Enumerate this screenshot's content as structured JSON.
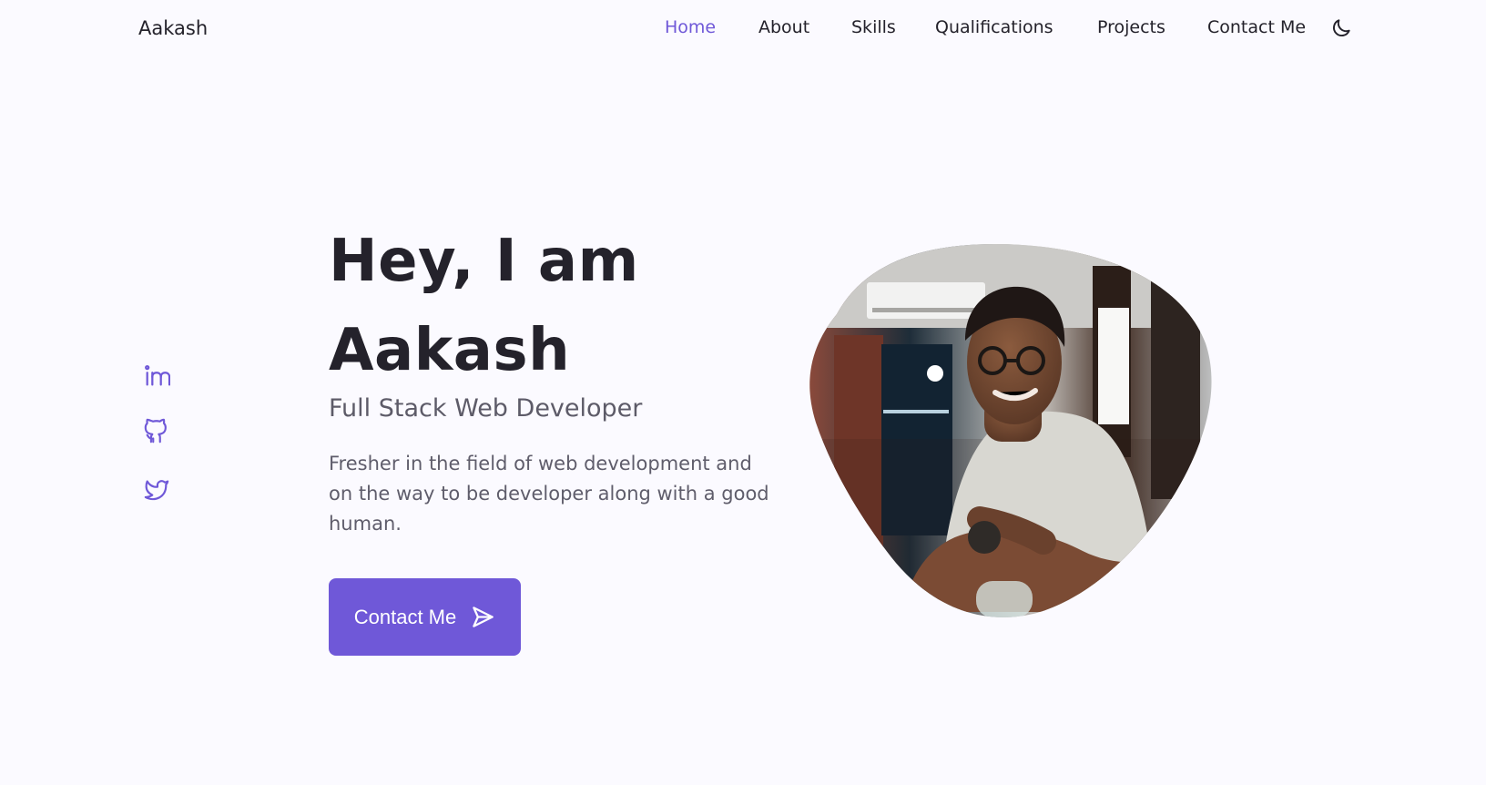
{
  "header": {
    "logo": "Aakash",
    "nav": [
      {
        "label": "Home",
        "active": true
      },
      {
        "label": "About",
        "active": false
      },
      {
        "label": "Skills",
        "active": false
      },
      {
        "label": "Qualifications",
        "active": false
      },
      {
        "label": "Projects",
        "active": false
      },
      {
        "label": "Contact Me",
        "active": false
      }
    ],
    "theme_toggle_icon": "moon-icon"
  },
  "socials": [
    {
      "name": "linkedin-icon"
    },
    {
      "name": "github-icon"
    },
    {
      "name": "twitter-icon"
    }
  ],
  "hero": {
    "title_line1": "Hey, I am",
    "title_line2": "Aakash",
    "subtitle": "Full Stack Web Developer",
    "description": "Fresher in the field of web development and on the way to be developer along with a good human.",
    "button_label": "Contact Me",
    "button_icon": "send-icon"
  },
  "colors": {
    "accent": "#6f58d8",
    "text": "#24222b",
    "muted_text": "#5f5d6b",
    "background": "#fbfaff"
  }
}
